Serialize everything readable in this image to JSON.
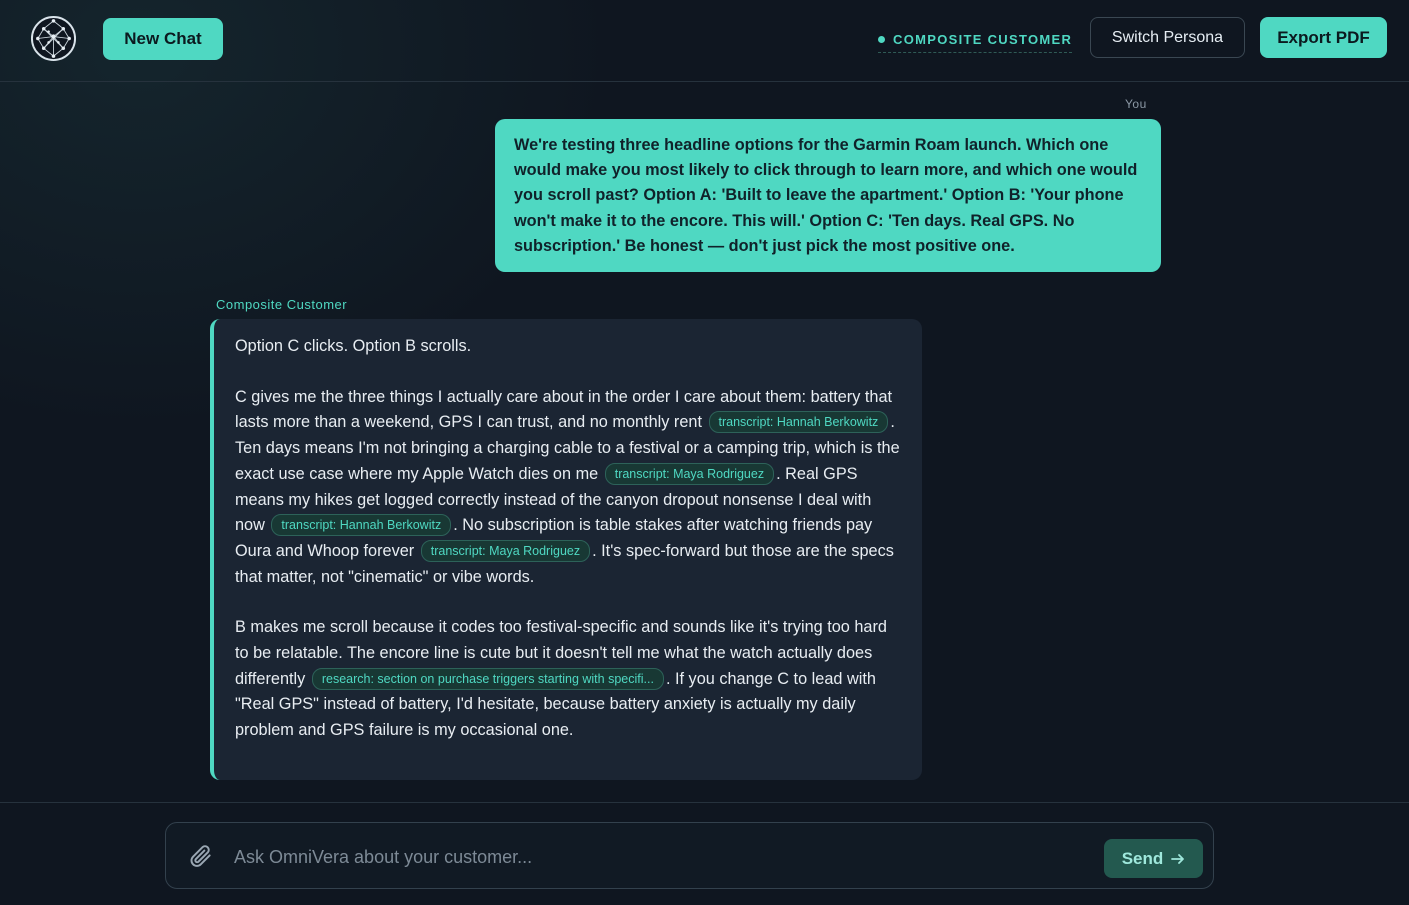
{
  "header": {
    "new_chat_label": "New Chat",
    "persona_label": "COMPOSITE CUSTOMER",
    "switch_persona_label": "Switch Persona",
    "export_label": "Export PDF",
    "accent_color": "#4fd8c2"
  },
  "messages": {
    "user": {
      "sender": "You",
      "text": "We're testing three headline options for the Garmin Roam launch. Which one would make you most likely to click through to learn more, and which one would you scroll past? Option A: 'Built to leave the apartment.' Option B: 'Your phone won't make it to the encore. This will.' Option C: 'Ten days. Real GPS. No subscription.' Be honest — don't just pick the most positive one."
    },
    "assistant": {
      "sender": "Composite Customer",
      "p1": "Option C clicks. Option B scrolls.",
      "p2_a": "C gives me the three things I actually care about in the order I care about them: battery that lasts more than a weekend, GPS I can trust, and no monthly rent",
      "cite1": "transcript: Hannah Berkowitz",
      "p2_b": ". Ten days means I'm not bringing a charging cable to a festival or a camping trip, which is the exact use case where my Apple Watch dies on me",
      "cite2": "transcript: Maya Rodriguez",
      "p2_c": ". Real GPS means my hikes get logged correctly instead of the canyon dropout nonsense I deal with now",
      "cite3": "transcript: Hannah Berkowitz",
      "p2_d": ". No subscription is table stakes after watching friends pay Oura and Whoop forever",
      "cite4": "transcript: Maya Rodriguez",
      "p2_e": ". It's spec-forward but those are the specs that matter, not \"cinematic\" or vibe words.",
      "p3_a": "B makes me scroll because it codes too festival-specific and sounds like it's trying too hard to be relatable. The encore line is cute but it doesn't tell me what the watch actually does differently",
      "cite5": "research: section on purchase triggers starting with specifi...",
      "p3_b": ". If you change C to lead with \"Real GPS\" instead of battery, I'd hesitate, because battery anxiety is actually my daily problem and GPS failure is my occasional one."
    }
  },
  "composer": {
    "placeholder": "Ask OmniVera about your customer...",
    "send_label": "Send",
    "attach_icon": "paperclip-icon",
    "send_icon": "arrow-right-icon"
  }
}
